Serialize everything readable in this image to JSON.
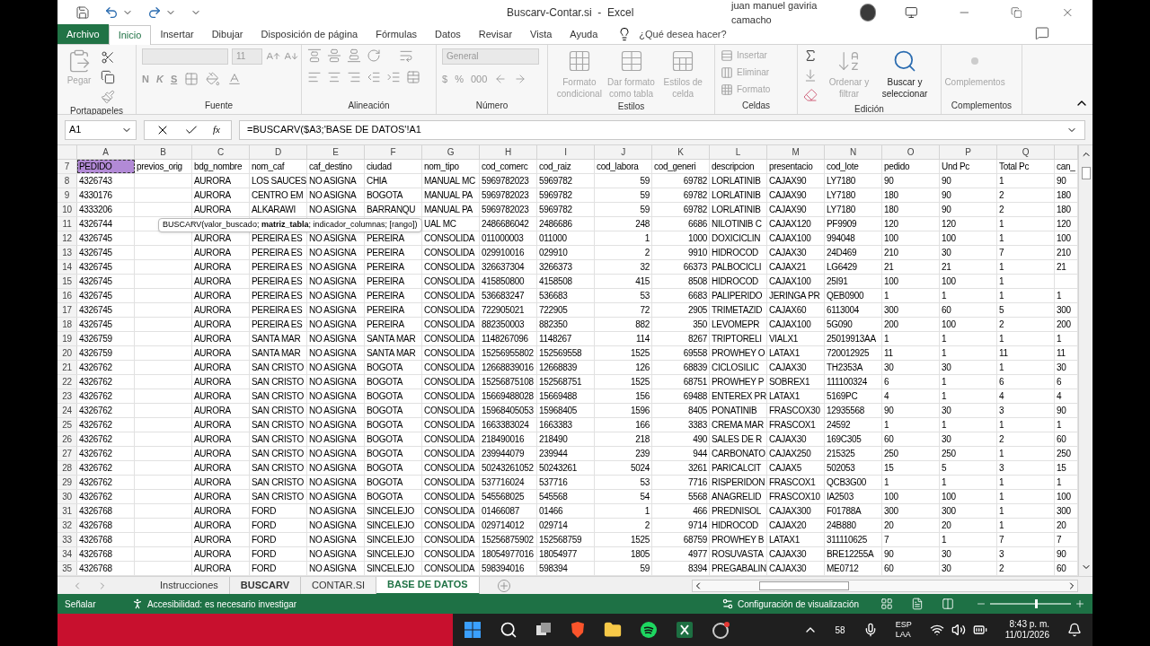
{
  "window": {
    "title": "Buscarv-Contar.si  -  Excel",
    "user": "juan manuel gaviria camacho"
  },
  "ribbon_tabs": [
    {
      "label": "Archivo",
      "kind": "file",
      "selected": false
    },
    {
      "label": "Inicio",
      "kind": "tab",
      "selected": true
    },
    {
      "label": "Insertar",
      "kind": "tab",
      "selected": false
    },
    {
      "label": "Dibujar",
      "kind": "tab",
      "selected": false
    },
    {
      "label": "Disposición de página",
      "kind": "tab",
      "selected": false
    },
    {
      "label": "Fórmulas",
      "kind": "tab",
      "selected": false
    },
    {
      "label": "Datos",
      "kind": "tab",
      "selected": false
    },
    {
      "label": "Revisar",
      "kind": "tab",
      "selected": false
    },
    {
      "label": "Vista",
      "kind": "tab",
      "selected": false
    },
    {
      "label": "Ayuda",
      "kind": "tab",
      "selected": false
    }
  ],
  "tell_me": "¿Qué desea hacer?",
  "ribbon": {
    "paste": "Pegar",
    "font_size": "11",
    "font_buttons": [
      "N",
      "K",
      "S"
    ],
    "number_format": "General",
    "number_buttons": [
      "$",
      "%",
      "000"
    ],
    "styles": [
      {
        "label": "Formato condicional",
        "disabled": true
      },
      {
        "label": "Dar formato como tabla",
        "disabled": true
      },
      {
        "label": "Estilos de celda",
        "disabled": true
      }
    ],
    "cells": [
      {
        "label": "Insertar",
        "disabled": true
      },
      {
        "label": "Eliminar",
        "disabled": true
      },
      {
        "label": "Formato",
        "disabled": true
      }
    ],
    "editing": [
      {
        "label": "Ordenar y filtrar",
        "disabled": true
      },
      {
        "label": "Buscar y seleccionar",
        "disabled": false
      }
    ],
    "addins": {
      "label": "Complementos",
      "disabled": true
    },
    "groups": [
      "Portapapeles",
      "Fuente",
      "Alineación",
      "Número",
      "Estilos",
      "Celdas",
      "Edición",
      "Complementos"
    ]
  },
  "formula_bar": {
    "name_box": "A1",
    "fx": "fx",
    "formula": "=BUSCARV($A3;'BASE DE DATOS'!A1"
  },
  "tooltip": "BUSCARV(valor_buscado; **matriz_tabla**; indicador_columnas; [rango])",
  "columns": [
    {
      "letter": "A",
      "header": "PEDIDO",
      "numeric": false,
      "highlighted": true
    },
    {
      "letter": "B",
      "header": "previos_orig",
      "highlighted": false
    },
    {
      "letter": "C",
      "header": "bdg_nombre",
      "numeric": false,
      "highlighted": false
    },
    {
      "letter": "D",
      "header": "nom_caf",
      "numeric": false,
      "highlighted": false
    },
    {
      "letter": "E",
      "header": "caf_destino",
      "numeric": false,
      "highlighted": false
    },
    {
      "letter": "F",
      "header": "ciudad",
      "numeric": false,
      "highlighted": false
    },
    {
      "letter": "G",
      "header": "nom_tipo",
      "numeric": false,
      "highlighted": false
    },
    {
      "letter": "H",
      "header": "cod_comerc",
      "numeric": false,
      "highlighted": false
    },
    {
      "letter": "I",
      "header": "cod_raiz",
      "numeric": false,
      "highlighted": false
    },
    {
      "letter": "J",
      "header": "cod_labora",
      "numeric": true,
      "highlighted": false
    },
    {
      "letter": "K",
      "header": "cod_generi",
      "numeric": true,
      "highlighted": false
    },
    {
      "letter": "L",
      "header": "descripcion",
      "numeric": false,
      "highlighted": false
    },
    {
      "letter": "M",
      "header": "presentacio",
      "numeric": false,
      "highlighted": false
    },
    {
      "letter": "N",
      "header": "cod_lote",
      "numeric": false,
      "highlighted": false
    },
    {
      "letter": "O",
      "header": "pedido",
      "numeric": false,
      "highlighted": false
    },
    {
      "letter": "P",
      "header": "Und Pc",
      "numeric": false,
      "highlighted": false
    },
    {
      "letter": "Q",
      "header": "Total Pc",
      "numeric": false,
      "highlighted": false
    },
    {
      "header": "can_",
      "numeric": false,
      "highlighted": false
    }
  ],
  "header_row": "7",
  "rows": [
    {
      "number": "8",
      "cells": [
        "4326743",
        null,
        "AURORA",
        "LOS SAUCES",
        "NO ASIGNA",
        "CHIA",
        "MANUAL MC",
        "5969782023",
        "5969782",
        "59",
        "69782",
        "LORLATINIB",
        "CAJAX90",
        "LY7180",
        "90",
        "90",
        "1",
        "90"
      ]
    },
    {
      "number": "9",
      "cells": [
        "4330176",
        null,
        "AURORA",
        "CENTRO EM",
        "NO ASIGNA",
        "BOGOTA",
        "MANUAL PA",
        "5969782023",
        "5969782",
        "59",
        "69782",
        "LORLATINIB",
        "CAJAX90",
        "LY7180",
        "180",
        "90",
        "2",
        "180"
      ]
    },
    {
      "number": "10",
      "cells": [
        "4333206",
        null,
        "AURORA",
        "ALKARAWI",
        "NO ASIGNA",
        "BARRANQU",
        "MANUAL PA",
        "5969782023",
        "5969782",
        "59",
        "69782",
        "LORLATINIB",
        "CAJAX90",
        "LY7180",
        "180",
        "90",
        "2",
        "180"
      ]
    },
    {
      "number": "11",
      "cells": [
        "4326744",
        null,
        null,
        null,
        null,
        null,
        "UAL MC",
        "2486686042",
        "2486686",
        "248",
        "6686",
        "NILOTINIB C",
        "CAJAX120",
        "PF9909",
        "120",
        "120",
        "1",
        "120"
      ]
    },
    {
      "number": "12",
      "cells": [
        "4326745",
        null,
        "AURORA",
        "PEREIRA ES",
        "NO ASIGNA",
        "PEREIRA",
        "CONSOLIDA",
        "011000003",
        "011000",
        "1",
        "1000",
        "DOXICICLIN",
        "CAJAX100",
        "994048",
        "100",
        "100",
        "1",
        "100"
      ]
    },
    {
      "number": "13",
      "cells": [
        "4326745",
        null,
        "AURORA",
        "PEREIRA ES",
        "NO ASIGNA",
        "PEREIRA",
        "CONSOLIDA",
        "029910016",
        "029910",
        "2",
        "9910",
        "HIDROCOD",
        "CAJAX30",
        "24D469",
        "210",
        "30",
        "7",
        "210"
      ]
    },
    {
      "number": "14",
      "cells": [
        "4326745",
        null,
        "AURORA",
        "PEREIRA ES",
        "NO ASIGNA",
        "PEREIRA",
        "CONSOLIDA",
        "326637304",
        "3266373",
        "32",
        "66373",
        "PALBOCICLI",
        "CAJAX21",
        "LG6429",
        "21",
        "21",
        "1",
        "21"
      ]
    },
    {
      "number": "15",
      "cells": [
        "4326745",
        null,
        "AURORA",
        "PEREIRA ES",
        "NO ASIGNA",
        "PEREIRA",
        "CONSOLIDA",
        "415850800",
        "4158508",
        "415",
        "8508",
        "HIDROCOD",
        "CAJAX100",
        "25I91",
        "100",
        "100",
        "1",
        null
      ]
    },
    {
      "number": "16",
      "cells": [
        "4326745",
        null,
        "AURORA",
        "PEREIRA ES",
        "NO ASIGNA",
        "PEREIRA",
        "CONSOLIDA",
        "536683247",
        "536683",
        "53",
        "6683",
        "PALIPERIDO",
        "JERINGA PR",
        "QEB0900",
        "1",
        "1",
        "1",
        "1"
      ]
    },
    {
      "number": "17",
      "cells": [
        "4326745",
        null,
        "AURORA",
        "PEREIRA ES",
        "NO ASIGNA",
        "PEREIRA",
        "CONSOLIDA",
        "722905021",
        "722905",
        "72",
        "2905",
        "TRIMETAZID",
        "CAJAX60",
        "6113004",
        "300",
        "60",
        "5",
        "300"
      ]
    },
    {
      "number": "18",
      "cells": [
        "4326745",
        null,
        "AURORA",
        "PEREIRA ES",
        "NO ASIGNA",
        "PEREIRA",
        "CONSOLIDA",
        "882350003",
        "882350",
        "882",
        "350",
        "LEVOMEPR",
        "CAJAX100",
        "5G090",
        "200",
        "100",
        "2",
        "200"
      ]
    },
    {
      "number": "19",
      "cells": [
        "4326759",
        null,
        "AURORA",
        "SANTA MAR",
        "NO ASIGNA",
        "SANTA MAR",
        "CONSOLIDA",
        "1148267096",
        "1148267",
        "114",
        "8267",
        "TRIPTORELI",
        "VIALX1",
        "25019913AA",
        "1",
        "1",
        "1",
        "1"
      ]
    },
    {
      "number": "20",
      "cells": [
        "4326759",
        null,
        "AURORA",
        "SANTA MAR",
        "NO ASIGNA",
        "SANTA MAR",
        "CONSOLIDA",
        "15256955802",
        "152569558",
        "1525",
        "69558",
        "PROWHEY O",
        "LATAX1",
        "720012925",
        "11",
        "1",
        "11",
        "11"
      ]
    },
    {
      "number": "21",
      "cells": [
        "4326762",
        null,
        "AURORA",
        "SAN CRISTO",
        "NO ASIGNA",
        "BOGOTA",
        "CONSOLIDA",
        "12668839016",
        "12668839",
        "126",
        "68839",
        "CICLOSILIC",
        "CAJAX30",
        "TH2353A",
        "30",
        "30",
        "1",
        "30"
      ]
    },
    {
      "number": "22",
      "cells": [
        "4326762",
        null,
        "AURORA",
        "SAN CRISTO",
        "NO ASIGNA",
        "BOGOTA",
        "CONSOLIDA",
        "15256875108",
        "152568751",
        "1525",
        "68751",
        "PROWHEY P",
        "SOBREX1",
        "111100324",
        "6",
        "1",
        "6",
        "6"
      ]
    },
    {
      "number": "23",
      "cells": [
        "4326762",
        null,
        "AURORA",
        "SAN CRISTO",
        "NO ASIGNA",
        "BOGOTA",
        "CONSOLIDA",
        "15669488028",
        "15669488",
        "156",
        "69488",
        "ENTEREX PR",
        "LATAX1",
        "5169PC",
        "4",
        "1",
        "4",
        "4"
      ]
    },
    {
      "number": "24",
      "cells": [
        "4326762",
        null,
        "AURORA",
        "SAN CRISTO",
        "NO ASIGNA",
        "BOGOTA",
        "CONSOLIDA",
        "15968405053",
        "15968405",
        "1596",
        "8405",
        "PONATINIB",
        "FRASCOX30",
        "12935568",
        "90",
        "30",
        "3",
        "90"
      ]
    },
    {
      "number": "25",
      "cells": [
        "4326762",
        null,
        "AURORA",
        "SAN CRISTO",
        "NO ASIGNA",
        "BOGOTA",
        "CONSOLIDA",
        "1663383024",
        "1663383",
        "166",
        "3383",
        "CREMA MAR",
        "FRASCOX1",
        "24592",
        "1",
        "1",
        "1",
        "1"
      ]
    },
    {
      "number": "26",
      "cells": [
        "4326762",
        null,
        "AURORA",
        "SAN CRISTO",
        "NO ASIGNA",
        "BOGOTA",
        "CONSOLIDA",
        "218490016",
        "218490",
        "218",
        "490",
        "SALES DE R",
        "CAJAX30",
        "169C305",
        "60",
        "30",
        "2",
        "60"
      ]
    },
    {
      "number": "27",
      "cells": [
        "4326762",
        null,
        "AURORA",
        "SAN CRISTO",
        "NO ASIGNA",
        "BOGOTA",
        "CONSOLIDA",
        "239944079",
        "239944",
        "239",
        "944",
        "CARBONATO",
        "CAJAX250",
        "215325",
        "250",
        "250",
        "1",
        "250"
      ]
    },
    {
      "number": "28",
      "cells": [
        "4326762",
        null,
        "AURORA",
        "SAN CRISTO",
        "NO ASIGNA",
        "BOGOTA",
        "CONSOLIDA",
        "50243261052",
        "50243261",
        "5024",
        "3261",
        "PARICALCIT",
        "CAJAX5",
        "502053",
        "15",
        "5",
        "3",
        "15"
      ]
    },
    {
      "number": "29",
      "cells": [
        "4326762",
        null,
        "AURORA",
        "SAN CRISTO",
        "NO ASIGNA",
        "BOGOTA",
        "CONSOLIDA",
        "537716024",
        "537716",
        "53",
        "7716",
        "RISPERIDON",
        "FRASCOX1",
        "QCB3G00",
        "1",
        "1",
        "1",
        "1"
      ]
    },
    {
      "number": "30",
      "cells": [
        "4326762",
        null,
        "AURORA",
        "SAN CRISTO",
        "NO ASIGNA",
        "BOGOTA",
        "CONSOLIDA",
        "545568025",
        "545568",
        "54",
        "5568",
        "ANAGRELID",
        "FRASCOX10",
        "IA2503",
        "100",
        "100",
        "1",
        "100"
      ]
    },
    {
      "number": "31",
      "cells": [
        "4326768",
        null,
        "AURORA",
        "FORD",
        "NO ASIGNA",
        "SINCELEJO",
        "CONSOLIDA",
        "01466087",
        "01466",
        "1",
        "466",
        "PREDNISOL",
        "CAJAX300",
        "F01788A",
        "300",
        "300",
        "1",
        "300"
      ]
    },
    {
      "number": "32",
      "cells": [
        "4326768",
        null,
        "AURORA",
        "FORD",
        "NO ASIGNA",
        "SINCELEJO",
        "CONSOLIDA",
        "029714012",
        "029714",
        "2",
        "9714",
        "HIDROCOD",
        "CAJAX20",
        "24B880",
        "20",
        "20",
        "1",
        "20"
      ]
    },
    {
      "number": "33",
      "cells": [
        "4326768",
        null,
        "AURORA",
        "FORD",
        "NO ASIGNA",
        "SINCELEJO",
        "CONSOLIDA",
        "15256875902",
        "152568759",
        "1525",
        "68759",
        "PROWHEY B",
        "LATAX1",
        "311110625",
        "7",
        "1",
        "7",
        "7"
      ]
    },
    {
      "number": "34",
      "cells": [
        "4326768",
        null,
        "AURORA",
        "FORD",
        "NO ASIGNA",
        "SINCELEJO",
        "CONSOLIDA",
        "18054977016",
        "18054977",
        "1805",
        "4977",
        "ROSUVASTA",
        "CAJAX30",
        "BRE12255A",
        "90",
        "30",
        "3",
        "90"
      ]
    },
    {
      "number": "35",
      "cells": [
        "4326768",
        null,
        "AURORA",
        "FORD",
        "NO ASIGNA",
        "SINCELEJO",
        "CONSOLIDA",
        "598394016",
        "598394",
        "59",
        "8394",
        "PREGABALIN",
        "CAJAX30",
        "ME0712",
        "60",
        "30",
        "2",
        "60"
      ]
    }
  ],
  "sheet_tabs": [
    {
      "label": "Instrucciones",
      "bold": false,
      "selected": false
    },
    {
      "label": "BUSCARV",
      "bold": true,
      "selected": false
    },
    {
      "label": "CONTAR.SI",
      "bold": false,
      "selected": false
    },
    {
      "label": "BASE DE DATOS",
      "bold": false,
      "selected": true
    }
  ],
  "status_bar": {
    "mode": "Señalar",
    "accessibility": "Accesibilidad: es necesario investigar",
    "display_settings": "Configuración de visualización",
    "zoom": {
      "level": 0.55
    }
  },
  "taskbar": {
    "tray_number": "58",
    "language": "ESP",
    "layout": "LAA",
    "time": "8:43 p. m.",
    "date": "11/01/2026"
  }
}
